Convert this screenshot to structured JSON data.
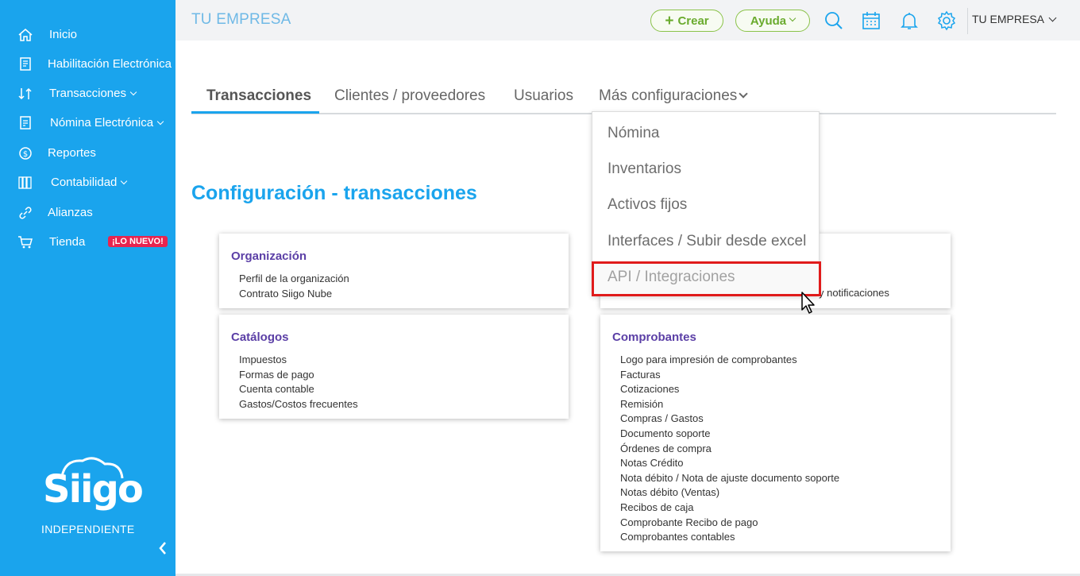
{
  "sidebar": {
    "items": [
      {
        "label": "Inicio",
        "icon": "home-icon"
      },
      {
        "label": "Habilitación Electrónica",
        "icon": "document-icon"
      },
      {
        "label": "Transacciones",
        "icon": "transactions-icon",
        "has_submenu": true
      },
      {
        "label": "Nómina Electrónica",
        "icon": "payroll-icon",
        "has_submenu": true
      },
      {
        "label": "Reportes",
        "icon": "money-icon"
      },
      {
        "label": "Contabilidad",
        "icon": "books-icon",
        "has_submenu": true
      },
      {
        "label": "Alianzas",
        "icon": "link-icon"
      },
      {
        "label": "Tienda",
        "icon": "cart-icon",
        "badge": "¡LO NUEVO!"
      }
    ],
    "logo_text": "Siigo",
    "logo_subtitle": "INDEPENDIENTE",
    "collapse_icon": "chevron-left-icon"
  },
  "topbar": {
    "company_title": "TU EMPRESA",
    "create_button": "Crear",
    "help_button": "Ayuda",
    "icons": [
      "search-icon",
      "calendar-icon",
      "bell-icon",
      "gear-icon"
    ],
    "user_menu": "TU EMPRESA"
  },
  "tabs": [
    {
      "label": "Transacciones",
      "active": true
    },
    {
      "label": "Clientes / proveedores",
      "active": false
    },
    {
      "label": "Usuarios",
      "active": false
    },
    {
      "label": "Más configuraciones",
      "active": false,
      "has_dropdown": true
    }
  ],
  "dropdown": {
    "items": [
      "Nómina",
      "Inventarios",
      "Activos fijos",
      "Interfaces / Subir desde excel",
      "API / Integraciones"
    ],
    "highlighted": "API / Integraciones"
  },
  "section_title": "Configuración - transacciones",
  "cards": {
    "organizacion": {
      "title": "Organización",
      "links": [
        "Perfil de la organización",
        "Contrato Siigo Nube"
      ]
    },
    "catalogos": {
      "title": "Catálogos",
      "links": [
        "Impuestos",
        "Formas de pago",
        "Cuenta contable",
        "Gastos/Costos frecuentes"
      ]
    },
    "partial_right": {
      "visible_text": "y notificaciones"
    },
    "comprobantes": {
      "title": "Comprobantes",
      "links": [
        "Logo para impresión de comprobantes",
        "Facturas",
        "Cotizaciones",
        "Remisión",
        "Compras / Gastos",
        "Documento soporte",
        "Órdenes de compra",
        "Notas Crédito",
        "Nota débito / Nota de ajuste documento soporte",
        "Notas débito (Ventas)",
        "Recibos de caja",
        "Comprobante Recibo de pago",
        "Comprobantes contables"
      ]
    }
  },
  "colors": {
    "sidebar": "#1aa4ed",
    "accent": "#1aa4ed",
    "green": "#6aab2e",
    "card_title": "#5b3fa6",
    "badge": "#e8244f",
    "highlight_border": "#e01b1b"
  }
}
